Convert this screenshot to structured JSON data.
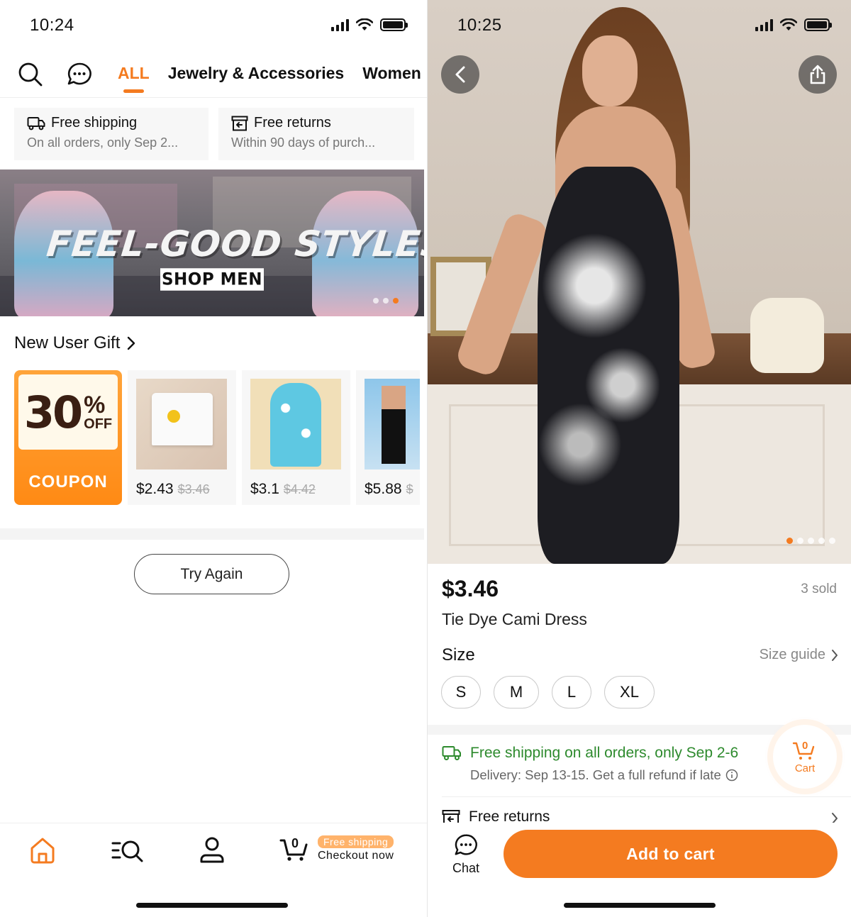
{
  "left": {
    "status": {
      "time": "10:24"
    },
    "nav": {
      "tabs": [
        {
          "label": "ALL",
          "active": true
        },
        {
          "label": "Jewelry & Accessories",
          "active": false
        },
        {
          "label": "Women",
          "active": false
        }
      ],
      "icons": [
        "search-icon",
        "chat-bubble-icon"
      ]
    },
    "promos": [
      {
        "title": "Free shipping",
        "subtitle": "On all orders, only Sep 2...",
        "icon": "truck-icon"
      },
      {
        "title": "Free returns",
        "subtitle": "Within 90 days of purch...",
        "icon": "returns-box-icon"
      }
    ],
    "banner": {
      "title": "FEEL-GOOD STYLES",
      "cta": "SHOP MEN"
    },
    "new_user_gift": {
      "title": "New User Gift",
      "coupon": {
        "number": "30",
        "percent": "%",
        "off": "OFF",
        "label": "COUPON"
      },
      "products": [
        {
          "price": "$2.43",
          "original": "$3.46"
        },
        {
          "price": "$3.1",
          "original": "$4.42"
        },
        {
          "price": "$5.88",
          "original": "$"
        }
      ]
    },
    "try_again": "Try Again",
    "tabbar": {
      "badge": "Free shipping",
      "checkout": "Checkout now",
      "cart_count": "0"
    }
  },
  "right": {
    "status": {
      "time": "10:25"
    },
    "product": {
      "price": "$3.46",
      "sold": "3 sold",
      "name": "Tie Dye Cami Dress",
      "size_label": "Size",
      "size_guide": "Size guide",
      "sizes": [
        "S",
        "M",
        "L",
        "XL"
      ]
    },
    "shipping": {
      "headline": "Free shipping on all orders, only Sep 2-6",
      "delivery": "Delivery: Sep 13-15. Get a full refund if late"
    },
    "returns": "Free returns",
    "cart": {
      "label": "Cart",
      "count": "0"
    },
    "bottom": {
      "chat": "Chat",
      "add_to_cart": "Add to cart"
    },
    "image_count": 5,
    "image_index": 1
  },
  "colors": {
    "accent": "#f47b20",
    "green": "#2d8a2d"
  }
}
